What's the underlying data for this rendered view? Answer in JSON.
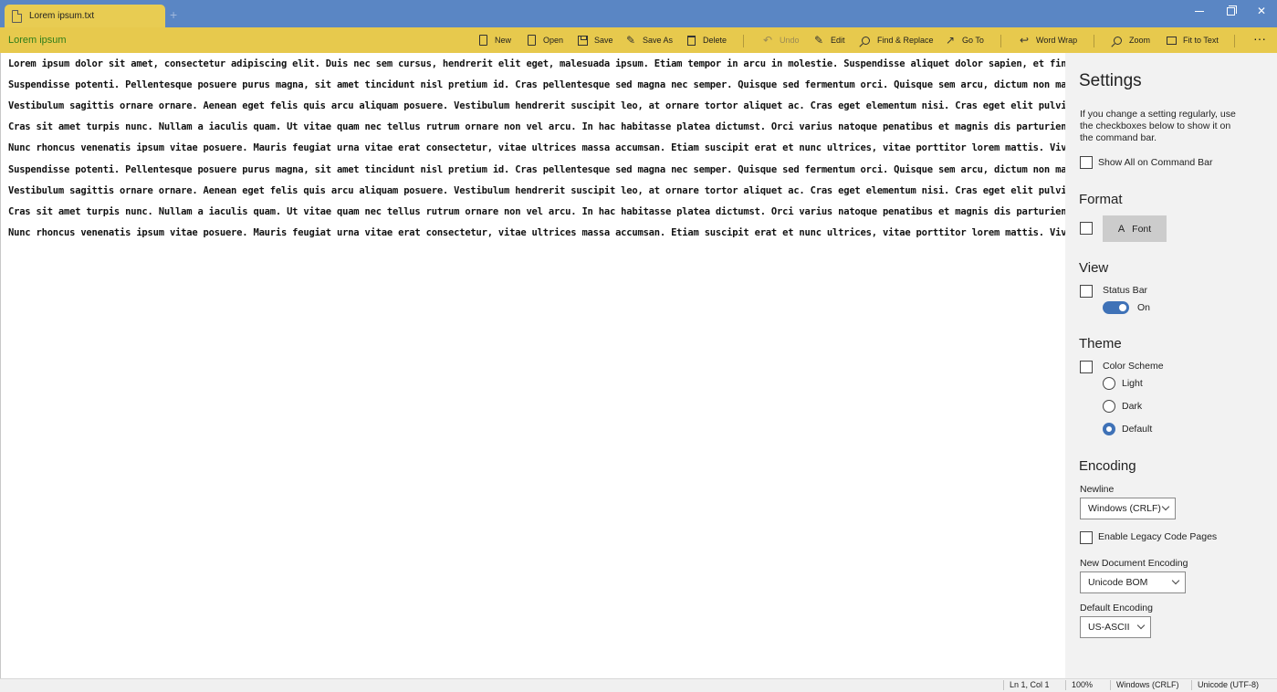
{
  "window": {
    "tab_title": "Lorem ipsum.txt",
    "new_tab_glyph": "+",
    "controls": {
      "minimize": "minimize-icon",
      "maximize": "restore-icon",
      "close": "✕"
    }
  },
  "colors": {
    "titlebar": "#5a86c4",
    "accent": "#e7c94d",
    "app_label": "#2d7d1a",
    "toggle": "#3f72b7"
  },
  "commandbar": {
    "app_label": "Lorem ipsum",
    "new": "New",
    "open": "Open",
    "save": "Save",
    "save_as": "Save As",
    "delete": "Delete",
    "undo": "Undo",
    "edit": "Edit",
    "find_replace": "Find & Replace",
    "go_to": "Go To",
    "word_wrap": "Word Wrap",
    "zoom": "Zoom",
    "fit_to_text": "Fit to Text",
    "more": "···"
  },
  "editor": {
    "lines": [
      "Lorem ipsum dolor sit amet, consectetur adipiscing elit. Duis nec sem cursus, hendrerit elit eget, malesuada ipsum. Etiam tempor in arcu in molestie. Suspendisse aliquet dolor sapien, et finibus puru",
      "Suspendisse potenti. Pellentesque posuere purus magna, sit amet tincidunt nisl pretium id. Cras pellentesque sed magna nec semper. Quisque sed fermentum orci. Quisque sem arcu, dictum non magna sed,",
      "Vestibulum sagittis ornare ornare. Aenean eget felis quis arcu aliquam posuere. Vestibulum hendrerit suscipit leo, at ornare tortor aliquet ac. Cras eget elementum nisi. Cras eget elit pulvinar, alic",
      "Cras sit amet turpis nunc. Nullam a iaculis quam. Ut vitae quam nec tellus rutrum ornare non vel arcu. In hac habitasse platea dictumst. Orci varius natoque penatibus et magnis dis parturient montes,",
      "Nunc rhoncus venenatis ipsum vitae posuere. Mauris feugiat urna vitae erat consectetur, vitae ultrices massa accumsan. Etiam suscipit erat et nunc ultrices, vitae porttitor lorem mattis. Vivamus risu",
      "Suspendisse potenti. Pellentesque posuere purus magna, sit amet tincidunt nisl pretium id. Cras pellentesque sed magna nec semper. Quisque sed fermentum orci. Quisque sem arcu, dictum non magna sed,",
      "Vestibulum sagittis ornare ornare. Aenean eget felis quis arcu aliquam posuere. Vestibulum hendrerit suscipit leo, at ornare tortor aliquet ac. Cras eget elementum nisi. Cras eget elit pulvinar, alic",
      "Cras sit amet turpis nunc. Nullam a iaculis quam. Ut vitae quam nec tellus rutrum ornare non vel arcu. In hac habitasse platea dictumst. Orci varius natoque penatibus et magnis dis parturient montes,",
      "Nunc rhoncus venenatis ipsum vitae posuere. Mauris feugiat urna vitae erat consectetur, vitae ultrices massa accumsan. Etiam suscipit erat et nunc ultrices, vitae porttitor lorem mattis. Vivamus risu"
    ]
  },
  "settings": {
    "title": "Settings",
    "description": "If you change a setting regularly, use the checkboxes below to show it on the command bar.",
    "show_all": "Show All on Command Bar",
    "format": {
      "heading": "Format",
      "font_button": "Font",
      "font_glyph": "A"
    },
    "view": {
      "heading": "View",
      "status_bar_label": "Status Bar",
      "toggle_state": "On",
      "toggle_on": true
    },
    "theme": {
      "heading": "Theme",
      "color_scheme_label": "Color Scheme",
      "options": [
        "Light",
        "Dark",
        "Default"
      ],
      "selected": "Default"
    },
    "encoding": {
      "heading": "Encoding",
      "newline_label": "Newline",
      "newline_value": "Windows (CRLF)",
      "legacy_label": "Enable Legacy Code Pages",
      "new_doc_label": "New Document Encoding",
      "new_doc_value": "Unicode BOM",
      "default_label": "Default Encoding",
      "default_value": "US-ASCII"
    }
  },
  "statusbar": {
    "position": "Ln 1, Col 1",
    "zoom": "100%",
    "line_ending": "Windows (CRLF)",
    "encoding": "Unicode (UTF-8)"
  }
}
